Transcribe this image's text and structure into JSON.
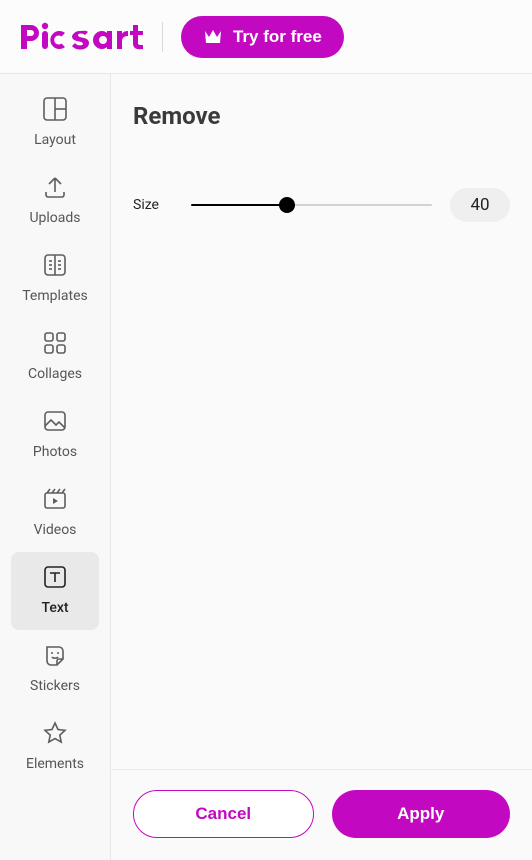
{
  "brand": {
    "name": "Picsart",
    "color": "#c209c1"
  },
  "header": {
    "try_label": "Try for free"
  },
  "sidebar": {
    "items": [
      {
        "id": "layout",
        "label": "Layout",
        "icon": "layout-icon"
      },
      {
        "id": "uploads",
        "label": "Uploads",
        "icon": "upload-icon"
      },
      {
        "id": "templates",
        "label": "Templates",
        "icon": "templates-icon"
      },
      {
        "id": "collages",
        "label": "Collages",
        "icon": "collages-icon"
      },
      {
        "id": "photos",
        "label": "Photos",
        "icon": "photo-icon"
      },
      {
        "id": "videos",
        "label": "Videos",
        "icon": "video-icon"
      },
      {
        "id": "text",
        "label": "Text",
        "icon": "text-icon"
      },
      {
        "id": "stickers",
        "label": "Stickers",
        "icon": "sticker-icon"
      },
      {
        "id": "elements",
        "label": "Elements",
        "icon": "star-icon"
      }
    ],
    "active_id": "text"
  },
  "panel": {
    "title": "Remove",
    "size_label": "Size",
    "size_value": 40,
    "size_min": 0,
    "size_max": 100
  },
  "footer": {
    "cancel_label": "Cancel",
    "apply_label": "Apply"
  }
}
